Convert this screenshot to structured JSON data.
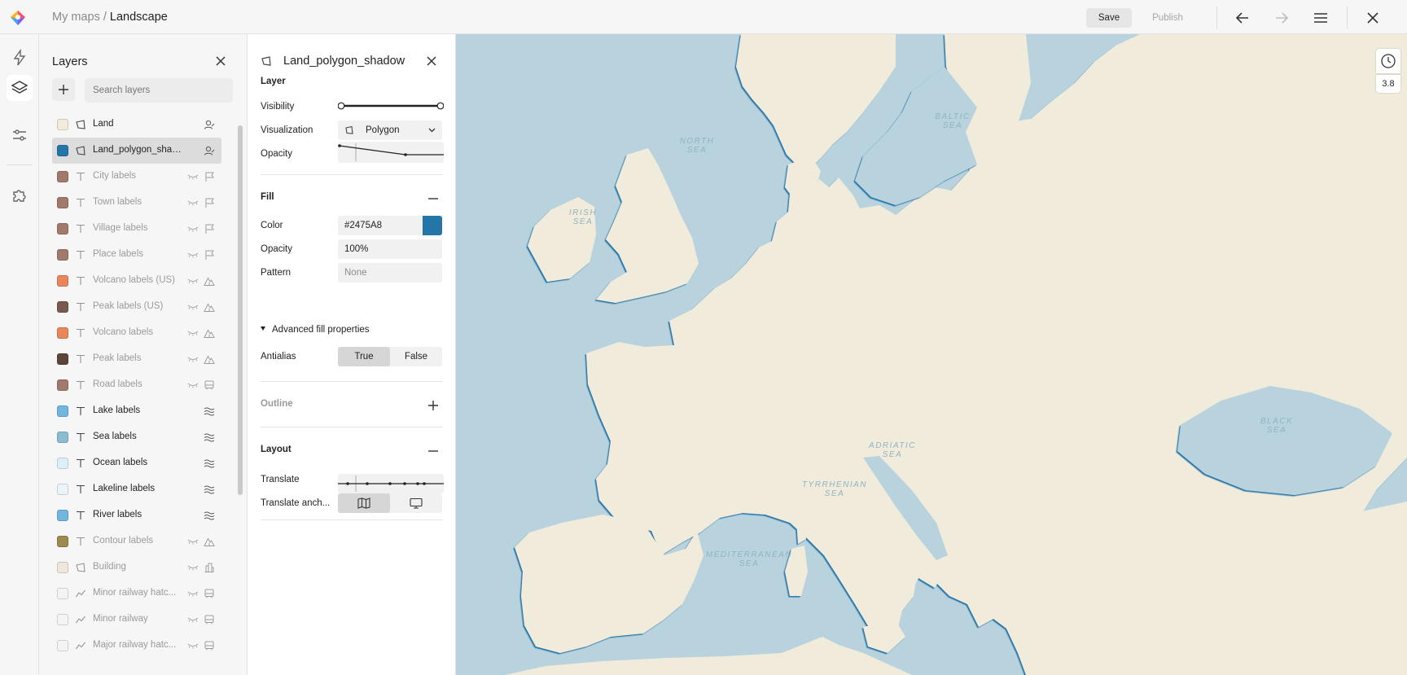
{
  "breadcrumb": {
    "parent": "My maps",
    "separator": " / ",
    "current": "Landscape"
  },
  "toolbar": {
    "save_label": "Save",
    "publish_label": "Publish"
  },
  "layers_panel": {
    "title": "Layers",
    "search_placeholder": "Search layers",
    "items": [
      {
        "name": "Land",
        "color": "#F1EBDB",
        "type": "polygon",
        "category": "person",
        "dim": false
      },
      {
        "name": "Land_polygon_shadow",
        "color": "#2475A8",
        "type": "polygon",
        "category": "person",
        "dim": false,
        "selected": true
      },
      {
        "name": "City labels",
        "color": "#A07A6A",
        "type": "text",
        "category": "flag",
        "dim": true
      },
      {
        "name": "Town labels",
        "color": "#A07A6A",
        "type": "text",
        "category": "flag",
        "dim": true
      },
      {
        "name": "Village labels",
        "color": "#A07A6A",
        "type": "text",
        "category": "flag",
        "dim": true
      },
      {
        "name": "Place labels",
        "color": "#A07A6A",
        "type": "text",
        "category": "flag",
        "dim": true
      },
      {
        "name": "Volcano labels (US)",
        "color": "#E9875A",
        "type": "text",
        "category": "mountain",
        "dim": true
      },
      {
        "name": "Peak labels (US)",
        "color": "#7A5A4C",
        "type": "text",
        "category": "mountain",
        "dim": true
      },
      {
        "name": "Volcano labels",
        "color": "#E9875A",
        "type": "text",
        "category": "mountain",
        "dim": true
      },
      {
        "name": "Peak labels",
        "color": "#5E4438",
        "type": "text",
        "category": "mountain",
        "dim": true
      },
      {
        "name": "Road labels",
        "color": "#A07A6A",
        "type": "text",
        "category": "bus",
        "dim": true
      },
      {
        "name": "Lake labels",
        "color": "#6FB6E0",
        "type": "text",
        "category": "water",
        "dim": false
      },
      {
        "name": "Sea labels",
        "color": "#8DBBD0",
        "type": "text",
        "category": "water",
        "dim": false
      },
      {
        "name": "Ocean labels",
        "color": "#DDEFF7",
        "type": "text",
        "category": "water",
        "dim": false
      },
      {
        "name": "Lakeline labels",
        "color": "#EAF4F9",
        "type": "text",
        "category": "water",
        "dim": false
      },
      {
        "name": "River labels",
        "color": "#6FB6E0",
        "type": "text",
        "category": "water",
        "dim": false
      },
      {
        "name": "Contour labels",
        "color": "#9E8A4E",
        "type": "text",
        "category": "mountain",
        "dim": true
      },
      {
        "name": "Building",
        "color": "#EFE7DA",
        "type": "polygon",
        "category": "building",
        "dim": true
      },
      {
        "name": "Minor railway hatc...",
        "color": "#F4F4F4",
        "type": "line",
        "category": "bus",
        "dim": true
      },
      {
        "name": "Minor railway",
        "color": "#F4F4F4",
        "type": "line",
        "category": "bus",
        "dim": true
      },
      {
        "name": "Major railway hatc...",
        "color": "#F4F4F4",
        "type": "line",
        "category": "bus",
        "dim": true
      }
    ]
  },
  "props_panel": {
    "title": "Land_polygon_shadow",
    "layer_section": {
      "title": "Layer",
      "visibility_label": "Visibility",
      "visibility_range": [
        0,
        1
      ],
      "visualization_label": "Visualization",
      "visualization_value": "Polygon",
      "opacity_label": "Opacity"
    },
    "fill_section": {
      "title": "Fill",
      "color_label": "Color",
      "color_value": "#2475A8",
      "opacity_label": "Opacity",
      "opacity_value": "100%",
      "pattern_label": "Pattern",
      "pattern_value": "None",
      "advanced_label": "Advanced fill properties",
      "antialias_label": "Antialias",
      "antialias_true": "True",
      "antialias_false": "False",
      "antialias_selected": "True"
    },
    "outline_section": {
      "title": "Outline"
    },
    "layout_section": {
      "title": "Layout",
      "translate_label": "Translate",
      "translate_anchor_label": "Translate anch..."
    }
  },
  "map": {
    "zoom": "3.8",
    "labels": {
      "north_sea": "North Sea",
      "irish_sea": "Irish Sea",
      "baltic_sea": "Baltic Sea",
      "adriatic_sea": "Adriatic Sea",
      "tyrrhenian_sea": "Tyrrhenian Sea",
      "mediterranean_sea": "Mediterranean Sea",
      "black_sea": "Black Sea"
    },
    "colors": {
      "water": "#B9D3DE",
      "land": "#F1EBDB",
      "shadow": "#2475A8"
    }
  }
}
